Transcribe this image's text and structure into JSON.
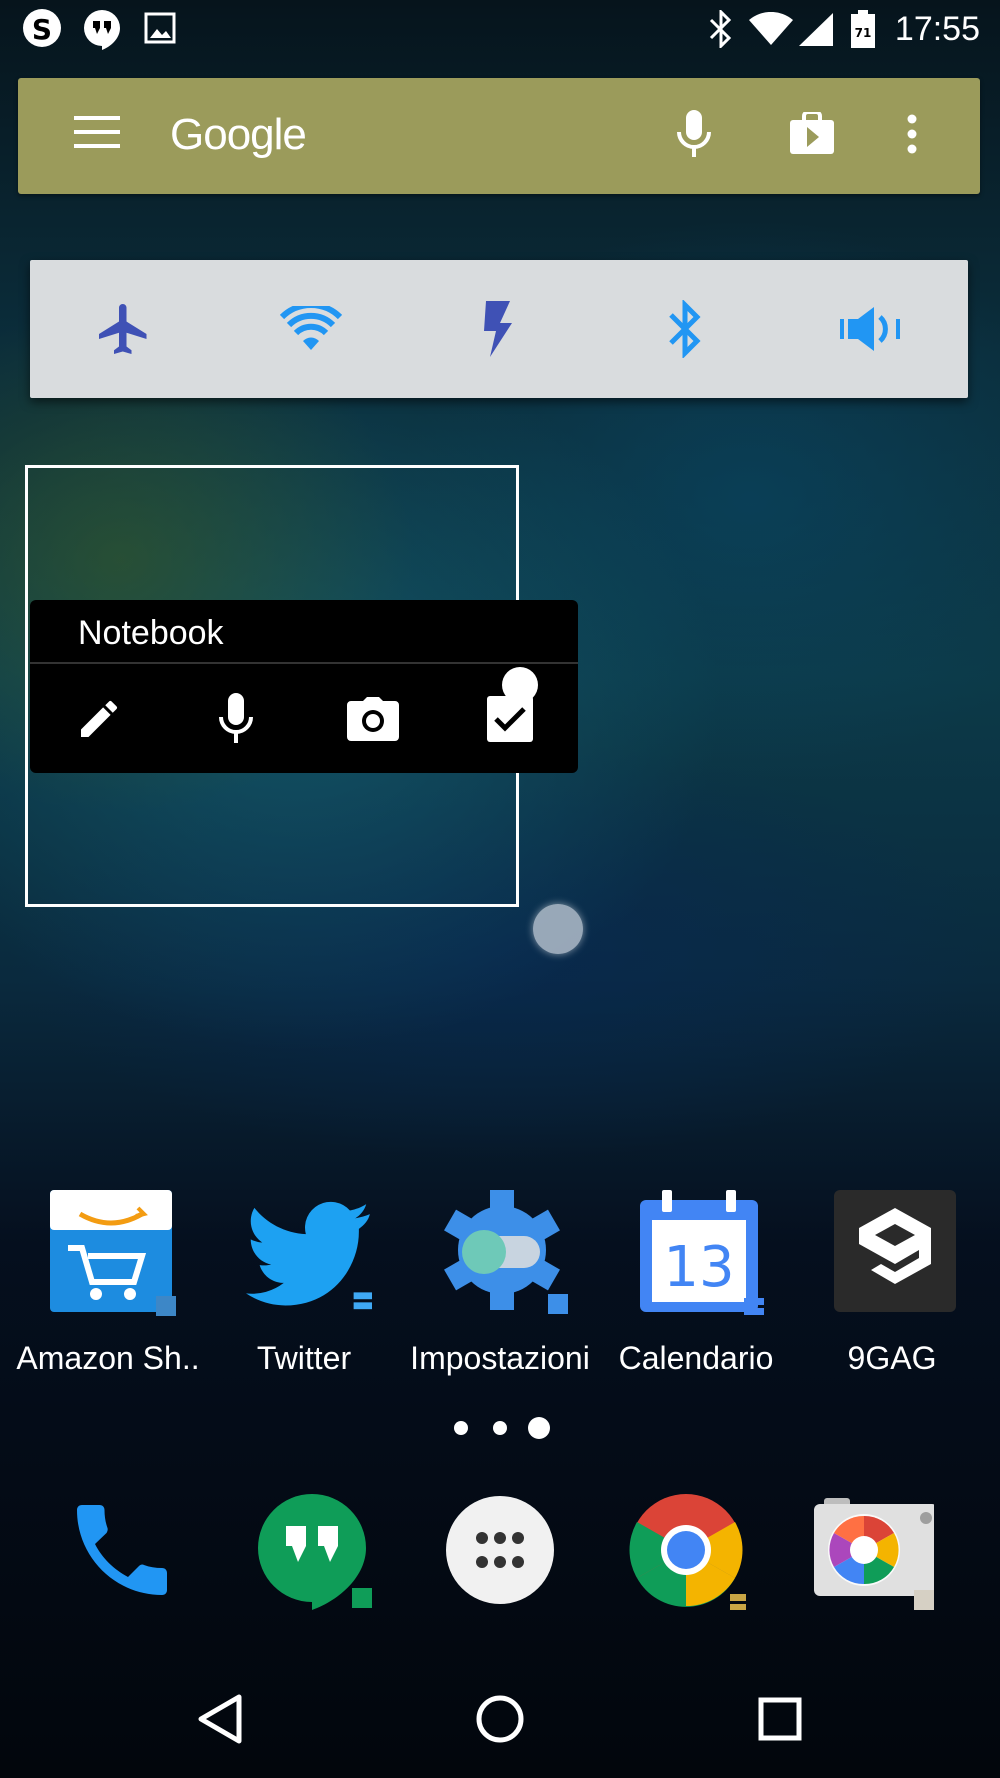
{
  "status_bar": {
    "time": "17:55",
    "left_icons": [
      "skype-icon",
      "hangouts-notification-icon",
      "image-notification-icon"
    ],
    "right_icons": [
      "bluetooth-icon",
      "wifi-icon",
      "cell-signal-icon",
      "battery-icon"
    ]
  },
  "google_bar": {
    "logo": "Google",
    "icons": [
      "menu-icon",
      "mic-icon",
      "play-store-icon",
      "overflow-menu-icon"
    ],
    "color": "#9b9b5b"
  },
  "quick_settings": {
    "toggles": [
      "airplane-icon",
      "wifi-icon",
      "flash-icon",
      "bluetooth-icon",
      "volume-icon"
    ]
  },
  "notebook_widget": {
    "title": "Notebook",
    "actions": [
      "pencil-icon",
      "mic-icon",
      "camera-icon",
      "checkbox-icon"
    ]
  },
  "apps": [
    {
      "label": "Amazon Sh..",
      "icon": "amazon-shopping-icon"
    },
    {
      "label": "Twitter",
      "icon": "twitter-icon"
    },
    {
      "label": "Impostazioni",
      "icon": "settings-icon"
    },
    {
      "label": "Calendario",
      "icon": "calendar-icon",
      "date": "13"
    },
    {
      "label": "9GAG",
      "icon": "9gag-icon"
    }
  ],
  "page_indicator": {
    "pages": 3,
    "current": 3
  },
  "dock": [
    "phone-icon",
    "hangouts-icon",
    "app-drawer-icon",
    "chrome-icon",
    "camera-icon"
  ],
  "nav": [
    "back-icon",
    "home-icon",
    "recents-icon"
  ]
}
